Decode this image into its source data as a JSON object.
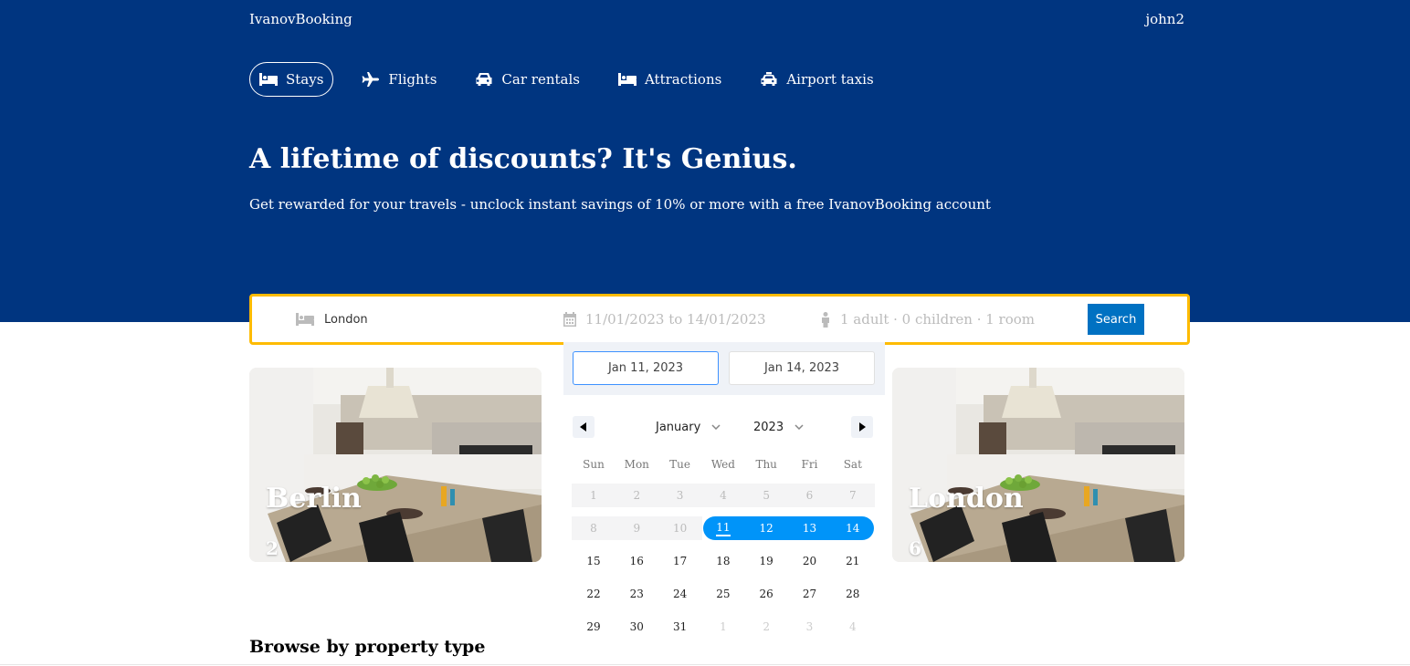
{
  "header": {
    "logo": "IvanovBooking",
    "user": "john2"
  },
  "tabs": [
    {
      "label": "Stays",
      "icon": "bed-icon",
      "active": true
    },
    {
      "label": "Flights",
      "icon": "plane-icon",
      "active": false
    },
    {
      "label": "Car rentals",
      "icon": "car-icon",
      "active": false
    },
    {
      "label": "Attractions",
      "icon": "bed-icon",
      "active": false
    },
    {
      "label": "Airport taxis",
      "icon": "taxi-icon",
      "active": false
    }
  ],
  "hero": {
    "title": "A lifetime of discounts? It's Genius.",
    "subtitle": "Get rewarded for your travels - unclock instant savings of 10% or more with a free IvanovBooking account"
  },
  "search": {
    "destination": "London",
    "dates": "11/01/2023 to 14/01/2023",
    "occupancy": "1 adult · 0 children · 1 room",
    "button": "Search"
  },
  "calendar": {
    "start_date": "Jan 11, 2023",
    "end_date": "Jan 14, 2023",
    "month": "January",
    "year": "2023",
    "weekdays": [
      "Sun",
      "Mon",
      "Tue",
      "Wed",
      "Thu",
      "Fri",
      "Sat"
    ],
    "weeks": [
      [
        "1",
        "2",
        "3",
        "4",
        "5",
        "6",
        "7"
      ],
      [
        "8",
        "9",
        "10",
        "11",
        "12",
        "13",
        "14"
      ],
      [
        "15",
        "16",
        "17",
        "18",
        "19",
        "20",
        "21"
      ],
      [
        "22",
        "23",
        "24",
        "25",
        "26",
        "27",
        "28"
      ],
      [
        "29",
        "30",
        "31",
        "1",
        "2",
        "3",
        "4"
      ]
    ]
  },
  "cards": [
    {
      "city": "Berlin",
      "count": "2"
    },
    {
      "city": "London",
      "count": "6"
    }
  ],
  "sections": {
    "browse_title": "Browse by property type"
  },
  "colors": {
    "brand_blue": "#003580",
    "search_border": "#febb02",
    "button_blue": "#0071c2",
    "range_blue": "#0094f9"
  }
}
